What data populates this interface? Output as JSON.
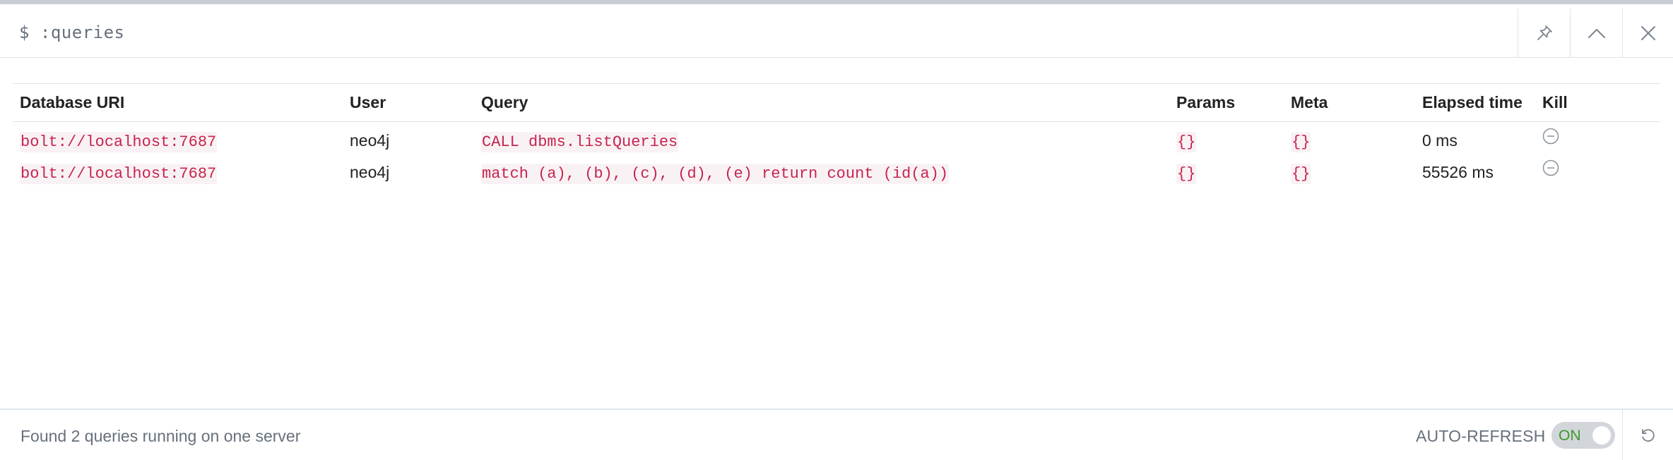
{
  "header": {
    "command": "$ :queries",
    "pin_icon": "pin-icon",
    "collapse_icon": "chevron-up-icon",
    "close_icon": "close-icon"
  },
  "table": {
    "columns": [
      "Database URI",
      "User",
      "Query",
      "Params",
      "Meta",
      "Elapsed time",
      "Kill"
    ],
    "rows": [
      {
        "uri": "bolt://localhost:7687",
        "user": "neo4j",
        "query": "CALL dbms.listQueries",
        "params": "{}",
        "meta": "{}",
        "elapsed": "0 ms",
        "kill_icon": "minus-circle-icon"
      },
      {
        "uri": "bolt://localhost:7687",
        "user": "neo4j",
        "query": "match (a), (b), (c), (d), (e) return count (id(a))",
        "params": "{}",
        "meta": "{}",
        "elapsed": "55526 ms",
        "kill_icon": "minus-circle-icon"
      }
    ]
  },
  "footer": {
    "status": "Found 2 queries running on one server",
    "auto_refresh_label": "AUTO-REFRESH",
    "toggle_state": "ON",
    "refresh_icon": "refresh-icon"
  },
  "colors": {
    "code_text": "#c7254e",
    "code_bg": "#f9f2f4",
    "toggle_on_text": "#3c9a2a",
    "muted_text": "#66707c"
  }
}
